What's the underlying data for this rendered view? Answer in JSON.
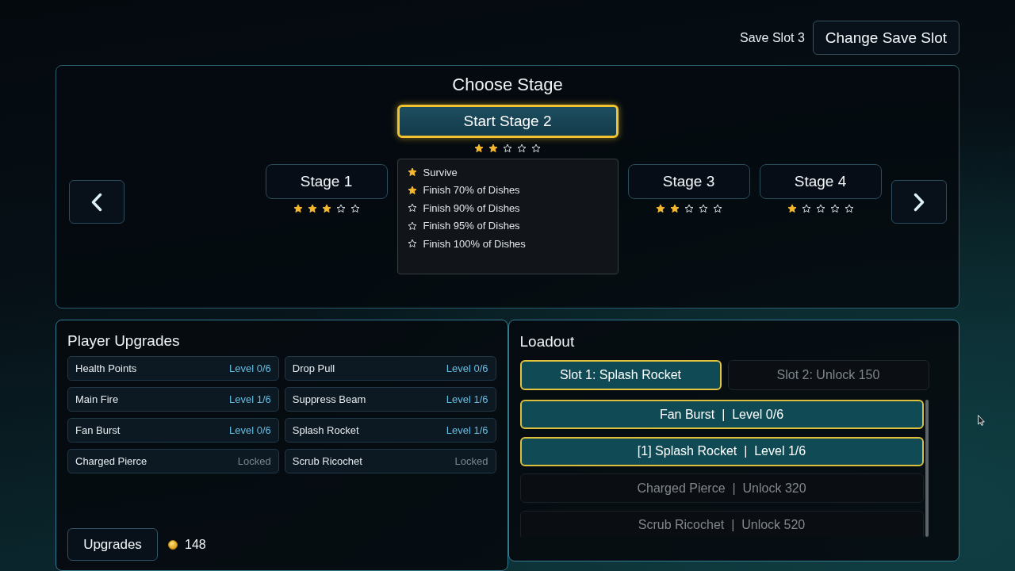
{
  "header": {
    "save_slot": "Save Slot 3",
    "change_button": "Change Save Slot"
  },
  "stage_select": {
    "title": "Choose Stage",
    "start_button": "Start Stage 2",
    "stars": 2,
    "objectives": [
      {
        "text": "Survive",
        "achieved": true
      },
      {
        "text": "Finish 70% of Dishes",
        "achieved": true
      },
      {
        "text": "Finish 90% of Dishes",
        "achieved": false
      },
      {
        "text": "Finish 95% of Dishes",
        "achieved": false
      },
      {
        "text": "Finish 100% of Dishes",
        "achieved": false
      }
    ],
    "stages_before": [
      {
        "label": "Stage 1",
        "stars": 3
      }
    ],
    "stages_after": [
      {
        "label": "Stage 3",
        "stars": 2
      },
      {
        "label": "Stage 4",
        "stars": 1
      }
    ]
  },
  "upgrades": {
    "title": "Player Upgrades",
    "items": [
      {
        "name": "Health Points",
        "status": "Level 0/6",
        "locked": false
      },
      {
        "name": "Drop Pull",
        "status": "Level 0/6",
        "locked": false
      },
      {
        "name": "Main Fire",
        "status": "Level 1/6",
        "locked": false
      },
      {
        "name": "Suppress Beam",
        "status": "Level 1/6",
        "locked": false
      },
      {
        "name": "Fan Burst",
        "status": "Level 0/6",
        "locked": false
      },
      {
        "name": "Splash Rocket",
        "status": "Level 1/6",
        "locked": false
      },
      {
        "name": "Charged Pierce",
        "status": "Locked",
        "locked": true
      },
      {
        "name": "Scrub Ricochet",
        "status": "Locked",
        "locked": true
      }
    ],
    "button": "Upgrades",
    "coins": "148"
  },
  "loadout": {
    "title": "Loadout",
    "slots": [
      {
        "label": "Slot 1: Splash Rocket",
        "selected": true
      },
      {
        "label": "Slot 2: Unlock 150",
        "selected": false
      }
    ],
    "weapons": [
      {
        "label": "Fan Burst  |  Level 0/6",
        "locked": false
      },
      {
        "label": "[1] Splash Rocket  |  Level 1/6",
        "locked": false
      },
      {
        "label": "Charged Pierce  |  Unlock 320",
        "locked": true
      },
      {
        "label": "Scrub Ricochet  |  Unlock 520",
        "locked": true
      }
    ]
  }
}
